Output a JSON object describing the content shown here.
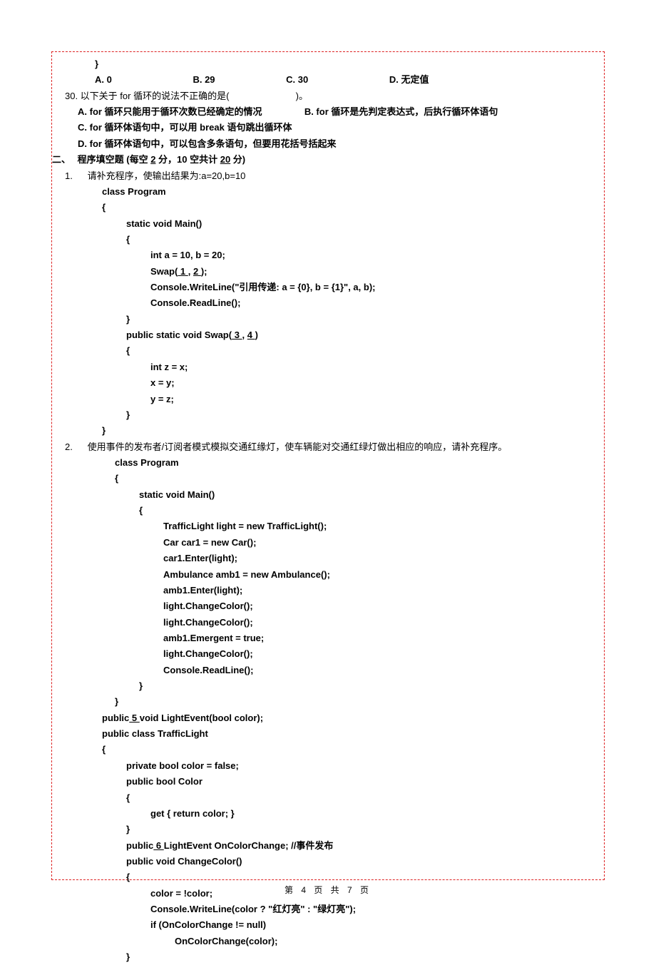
{
  "q29": {
    "closeBrace": "}",
    "optA": "A. 0",
    "optB": "B. 29",
    "optC": "C. 30",
    "optD": "D. 无定值"
  },
  "q30": {
    "stem_pre": "30. 以下关于 for 循环的说法不正确的是(",
    "stem_post": ")。",
    "optA": "A. for 循环只能用于循环次数已经确定的情况",
    "optB": "B. for 循环是先判定表达式，后执行循环体语句",
    "optC": "C. for 循环体语句中，可以用 break 语句跳出循环体",
    "optD": "D. for 循环体语句中，可以包含多条语句，但要用花括号括起来"
  },
  "section2": {
    "num": "二、",
    "title_pre": "程序填空题  (每空 ",
    "title_mid1": "2",
    "title_mid2": " 分，10 空共计 ",
    "title_mid3": "20",
    "title_post": " 分)"
  },
  "fill1": {
    "num": "1.",
    "stem": "请补充程序，使输出结果为:a=20,b=10",
    "c0": "class Program",
    "c1": "{",
    "c2": "static void Main()",
    "c3": "{",
    "c4": "int a = 10, b = 20;",
    "c5_pre": "Swap(",
    "c5_b1": "         1         ",
    "c5_comma": ", ",
    "c5_b2": "           2           ",
    "c5_post": ");",
    "c6": "Console.WriteLine(\"引用传递: a = {0}, b = {1}\", a, b);",
    "c7": "Console.ReadLine();",
    "c8": "}",
    "c9_pre": "public static void Swap(",
    "c9_b3": "         3        ",
    "c9_comma": ",       ",
    "c9_b4": "        4         ",
    "c9_post": ")",
    "c10": "{",
    "c11": "int z = x;",
    "c12": "x = y;",
    "c13": "y = z;",
    "c14": "}",
    "c15": "}"
  },
  "fill2": {
    "num": "2.",
    "stem": "使用事件的发布者/订阅者模式模拟交通红缘灯，使车辆能对交通红绿灯做出相应的响应，请补充程序。",
    "c0": "class Program",
    "c1": "{",
    "c2": "static void Main()",
    "c3": "{",
    "c4": "TrafficLight light = new TrafficLight();",
    "c5": "Car car1 = new Car();",
    "c6": "car1.Enter(light);",
    "c7": "Ambulance amb1 = new Ambulance();",
    "c8": "amb1.Enter(light);",
    "c9": "light.ChangeColor();",
    "c10": "light.ChangeColor();",
    "c11": "amb1.Emergent = true;",
    "c12": "light.ChangeColor();",
    "c13": "Console.ReadLine();",
    "c14": "}",
    "c15": "}",
    "c16_pre": "public",
    "c16_b5": "              5                    ",
    "c16_post": "  void LightEvent(bool color);",
    "c17": "public class TrafficLight",
    "c18": "{",
    "c19": "private bool color = false;",
    "c20": "public bool Color",
    "c21": "{",
    "c22": "get { return color; }",
    "c23": "}",
    "c24_pre": "public",
    "c24_b6": "           6              ",
    "c24_post": "LightEvent OnColorChange; //事件发布",
    "c25": "public void ChangeColor()",
    "c26": "{",
    "c27": "color = !color;",
    "c28": "Console.WriteLine(color ? \"红灯亮\" : \"绿灯亮\");",
    "c29": "if (OnColorChange != null)",
    "c30": "OnColorChange(color);",
    "c31": "}"
  },
  "footer": "第 4 页 共 7 页"
}
